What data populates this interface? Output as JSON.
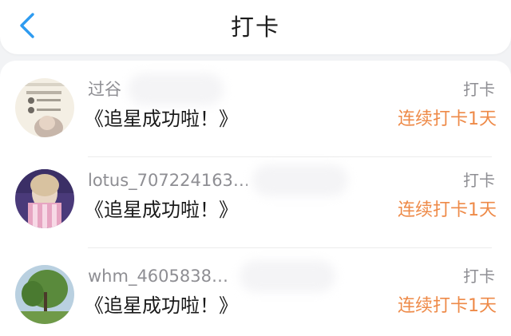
{
  "header": {
    "title": "打卡",
    "back_icon": "chevron-left-icon",
    "accent_color": "#2e9bf0"
  },
  "colors": {
    "streak": "#ee8a48",
    "muted": "#8e8e93"
  },
  "feed": [
    {
      "user_name": "过谷",
      "avatar": "avatar-screenshot-photo",
      "content": "《追星成功啦！》",
      "action": "打卡",
      "streak": "连续打卡1天"
    },
    {
      "user_name": "lotus_707224163…",
      "avatar": "avatar-pink-scarf-portrait",
      "content": "《追星成功啦！》",
      "action": "打卡",
      "streak": "连续打卡1天"
    },
    {
      "user_name": "whm_4605838…",
      "avatar": "avatar-green-tree-landscape",
      "content": "《追星成功啦！》",
      "action": "打卡",
      "streak": "连续打卡1天"
    }
  ]
}
